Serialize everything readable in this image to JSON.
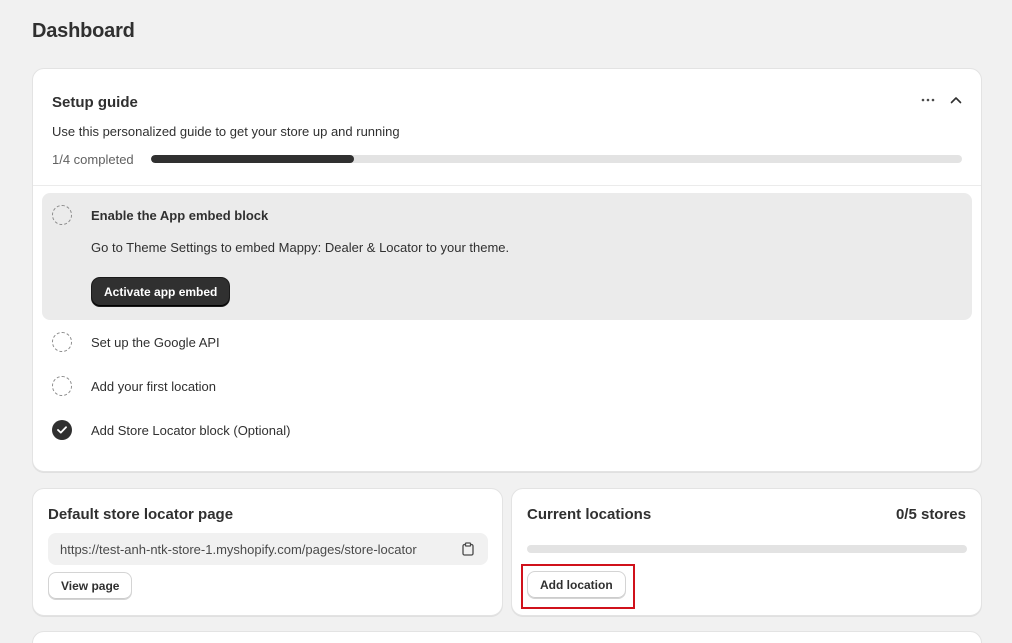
{
  "page": {
    "title": "Dashboard"
  },
  "setup_guide": {
    "title": "Setup guide",
    "description": "Use this personalized guide to get your store up and running",
    "progress_label": "1/4 completed",
    "progress_fraction": 0.25,
    "more_icon": "ellipsis-icon",
    "collapse_icon": "chevron-up-icon",
    "steps": [
      {
        "title": "Enable the App embed block",
        "description": "Go to Theme Settings to embed Mappy: Dealer & Locator to your theme.",
        "button_label": "Activate app embed",
        "completed": false
      },
      {
        "title": "Set up the Google API",
        "completed": false
      },
      {
        "title": "Add your first location",
        "completed": false
      },
      {
        "title": "Add Store Locator block (Optional)",
        "completed": true
      }
    ]
  },
  "store_locator_page": {
    "title": "Default store locator page",
    "url": "https://test-anh-ntk-store-1.myshopify.com/pages/store-locator",
    "copy_icon": "clipboard-icon",
    "button_label": "View page"
  },
  "current_locations": {
    "title": "Current locations",
    "count_label": "0/5 stores",
    "used_fraction": 0,
    "button_label": "Add location",
    "highlight_color": "#d0111b"
  }
}
